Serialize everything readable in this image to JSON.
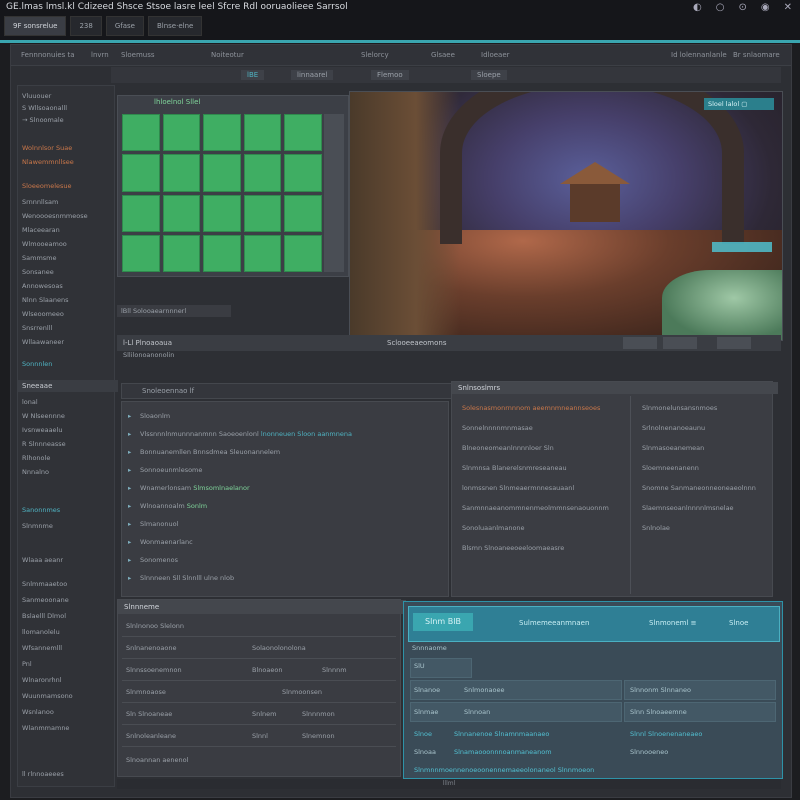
{
  "window": {
    "title": "GE.lmas lmsl.kl Cdizeed Shsce Stsoe lasre leel Sfcre Rdl ooruaolieee Sarrsol",
    "tabs": [
      "9F sonsrelue",
      "238",
      "Gfase",
      "Blnse·elne"
    ],
    "controls": [
      "◐",
      "○",
      "⊙",
      "◉",
      "✕"
    ]
  },
  "menubar": {
    "items": [
      "Fennnonuies ta",
      "lnvrn",
      "Sloemuss",
      "Noiteotur",
      "Slelorcy",
      "Glsaee",
      "Idloeaer",
      "Id lolennanlanle",
      "Br snlaomare"
    ]
  },
  "toolbar": {
    "items": [
      "lBE",
      "linnaarel",
      "Flemoo",
      "Sloepe"
    ]
  },
  "sidebar": {
    "items": [
      "Vluuouer",
      "S Wllsoaonalll",
      "→ Slnoomale",
      "Wolnnlsor Suae",
      "Nlawemmnllsee",
      "Sloeeomelesue",
      "Srnnnllsam",
      "Wenoooesnmmeose",
      "Mlaceearan",
      "Wlmooeamoo",
      "Sammsme",
      "Sonsanee",
      "Annowesoas",
      "Nlnn Slaanens",
      "Wlseoomeeo",
      "Snsrrenlll",
      "Wllaawaneer",
      "Sonnnlen",
      "Sneeaae",
      "lonal",
      "W Nlseennne",
      "Ivsnweaaelu",
      "R Slnnneasse",
      "Rlhonole",
      "Nnnalno",
      "Sanonnmes",
      "Slnmnme"
    ],
    "lower": [
      "Wlaaa aeanr",
      "Snlmmaaetoo",
      "Sanmeoonane",
      "Bslaelll Dlmol",
      "llomanolelu",
      "Wfsannemlll",
      "Pnl",
      "Wlnaronrhnl",
      "Wuunmamsono",
      "Wsnlanoo",
      "Wlanmmamne"
    ],
    "footer": "ll rlnnoaeees"
  },
  "grid_panel": {
    "header": "lhloelnol Sllel"
  },
  "viewport": {
    "label": "Sloel lalol ▢"
  },
  "status_strip": "lBll   Solooaearnnnerl",
  "mid_bar": {
    "left": "l-Ll  Plnoaoaua",
    "left2": "Sllilonoanonolin",
    "center": "Sclooeeaeomons"
  },
  "search": {
    "value": "Snoleoennao lf"
  },
  "list": {
    "rows": [
      {
        "icon": "▸",
        "text": "Sloaonlm",
        "style": ""
      },
      {
        "icon": "▸",
        "text": "Vlssnnnlnmunnnanmnn Saoeoenlonl",
        "hl": "lnonneuen Sloon aanmnena",
        "style": ""
      },
      {
        "icon": "▸",
        "text": "Bonnuanemllen Bnnsdmea Sleuonannelem",
        "style": ""
      },
      {
        "icon": "▸",
        "text": "Sonnoeunmlesome",
        "style": ""
      },
      {
        "icon": "▸",
        "text": "Wnamerlonsam",
        "gr": "Slmsomlnaelanor",
        "style": ""
      },
      {
        "icon": "▸",
        "text": "Wlnoannoalm",
        "gr": "Sonlm",
        "style": ""
      },
      {
        "icon": "▸",
        "text": "Slmanonuol",
        "style": ""
      },
      {
        "icon": "▸",
        "text": "Wonmaenarlanc",
        "style": ""
      },
      {
        "icon": "▸",
        "text": "Sonomenos",
        "style": ""
      },
      {
        "icon": "▸",
        "text": "Slnnneen Sll Slnnlll ulne nlob",
        "style": ""
      }
    ]
  },
  "props": {
    "header": "Snlnsoslmrs",
    "left": [
      {
        "t": "Solesnasmonrnnnom aeemnmneannseoes",
        "c": "orange"
      },
      {
        "t": "Sonnelnnnnmnmasae",
        "c": ""
      },
      {
        "t": "Blneoneomeanlnnnnloer  Sln",
        "c": ""
      },
      {
        "t": "Slnmnsa Blanerelsnmreseaneau",
        "c": ""
      },
      {
        "t": "lonmssnen Slnmeaermnnesauaanl",
        "c": ""
      },
      {
        "t": "Sanmnnaeanommnenmeolmmnsenaouonnm",
        "c": ""
      },
      {
        "t": "Sonoluaanlmanone",
        "c": ""
      },
      {
        "t": "Blsmn  Slnoaneeoeeloomaeasre",
        "c": ""
      }
    ],
    "right": [
      {
        "t": "Slnmonelunsansnmoes",
        "c": ""
      },
      {
        "t": "Srlnolnenanoeaunu",
        "c": ""
      },
      {
        "t": "Slnmasoeanemean",
        "c": ""
      },
      {
        "t": "Sloemneenanenn",
        "c": ""
      },
      {
        "t": "Snomne  Sanmaneonneoneaeolnnn",
        "c": ""
      },
      {
        "t": "Slaemnseoanlnnnnlmsnelae",
        "c": ""
      },
      {
        "t": "Snlnolae",
        "c": ""
      }
    ]
  },
  "table": {
    "header": "Slnnneme",
    "rows": [
      [
        "Slnlnonoo  Slelonn",
        "",
        ""
      ],
      [
        "Snlnanenoaone",
        "Solaonolonolona",
        ""
      ],
      [
        "Slnnssoenemnon",
        "Blnoaeon",
        "Slnnnm"
      ],
      [
        "Slnmnoaose",
        "Slnmoonsen",
        ""
      ],
      [
        "Sln Slnoaneae",
        "Snlnem",
        "Slnnnmon"
      ],
      [
        "Snlnoleanleane",
        "Slnnl",
        "Slnemnon"
      ],
      [
        "Slnoannan aenenol",
        "",
        ""
      ]
    ]
  },
  "blue_panel": {
    "head_btn": "Slnm BlB",
    "head_mid": "Sulmemeeanmnaen",
    "head_r1": "Slnmoneml  ≡",
    "head_r2": "Slnoe",
    "tab": "Snnnaome",
    "rows": [
      {
        "a": "SlU",
        "b": "",
        "c": ""
      },
      {
        "a": "Slnanoe",
        "b": "Snlmonaoee",
        "c": "Slnnonm  Slnnaneo"
      },
      {
        "a": "Slnmae",
        "b": "Slnnoan",
        "c": "Slnn   Slnoaeemne"
      },
      {
        "a": "Slnoe",
        "b": "Slnnanenoe  Slnamnmaanaeo",
        "c": "Slnnl  Slnoenenaneaeo"
      },
      {
        "a": "Slnoaa",
        "b": "Slnamaooonnnoanmaneanom",
        "c": "Slnnooeneo"
      },
      {
        "a": "Slnmnnmoennenoeoonennemaeeolonaneol Slnnmoeon",
        "b": "",
        "c": ""
      }
    ]
  },
  "footer": "lllml"
}
